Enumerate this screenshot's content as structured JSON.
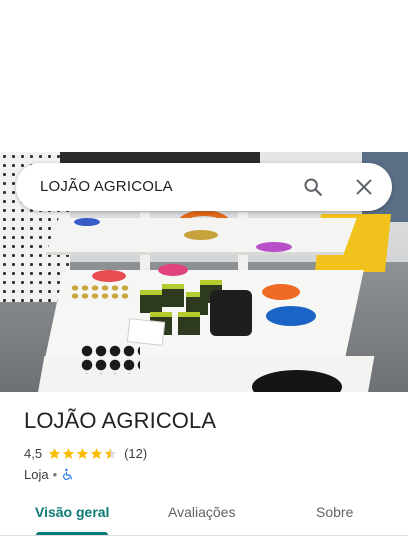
{
  "search": {
    "query": "LOJÃO AGRICOLA",
    "search_icon": "search-icon",
    "close_icon": "close-icon"
  },
  "place": {
    "name": "LOJÃO AGRICOLA",
    "rating": "4,5",
    "rating_value": 4.5,
    "reviews": "(12)",
    "category": "Loja",
    "separator": "•",
    "accessibility_icon": "wheelchair-icon"
  },
  "tabs": [
    {
      "label": "Visão geral",
      "active": true
    },
    {
      "label": "Avaliações",
      "active": false
    },
    {
      "label": "Sobre",
      "active": false
    }
  ],
  "colors": {
    "accent": "#0b7a75",
    "star": "#fbbc04",
    "access": "#1a73e8"
  }
}
